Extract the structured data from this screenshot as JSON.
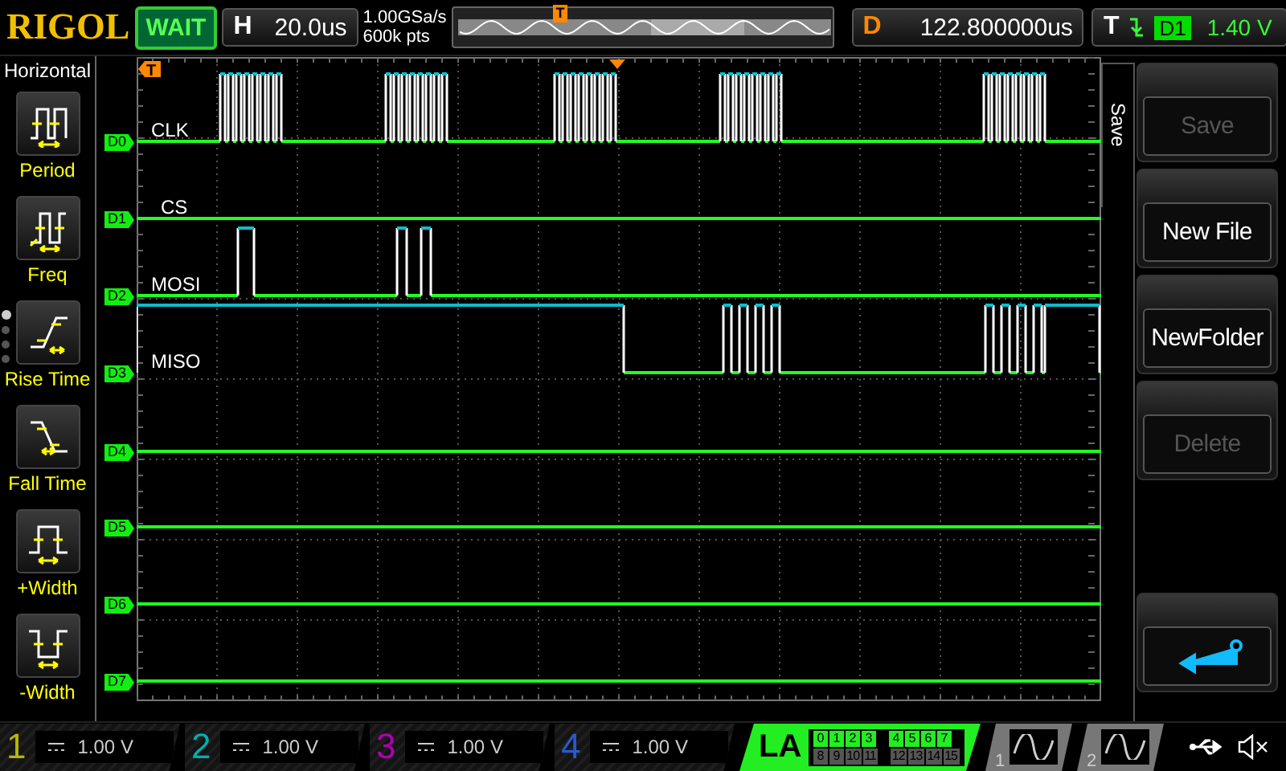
{
  "header": {
    "logo": "RIGOL",
    "run_status": "WAIT",
    "timebase": {
      "label": "H",
      "value": "20.0us"
    },
    "acquisition": {
      "sample_rate": "1.00GSa/s",
      "memory_depth": "600k pts"
    },
    "memory_marker": "T",
    "delay": {
      "label": "D",
      "value": "122.800000us"
    },
    "trigger": {
      "label": "T",
      "source": "D1",
      "threshold": "1.40 V"
    }
  },
  "measure_menu": {
    "title": "Horizontal",
    "items": [
      {
        "kind": "period",
        "label": "Period"
      },
      {
        "kind": "freq",
        "label": "Freq"
      },
      {
        "kind": "rise",
        "label": "Rise Time"
      },
      {
        "kind": "fall",
        "label": "Fall Time"
      },
      {
        "kind": "pwidth",
        "label": "+Width"
      },
      {
        "kind": "nwidth",
        "label": "-Width"
      }
    ],
    "pages": [
      {
        "selected": true
      },
      {
        "selected": false
      },
      {
        "selected": false
      },
      {
        "selected": false
      }
    ]
  },
  "plot": {
    "trigger_marker": "T",
    "channels": [
      {
        "label": "D0",
        "name": "CLK"
      },
      {
        "label": "D1",
        "name": "CS"
      },
      {
        "label": "D2",
        "name": "MOSI"
      },
      {
        "label": "D3",
        "name": "MISO"
      },
      {
        "label": "D4"
      },
      {
        "label": "D5"
      },
      {
        "label": "D6"
      },
      {
        "label": "D7"
      }
    ]
  },
  "softkeys": {
    "menu_title": "Save",
    "buttons": [
      {
        "kind": "text",
        "label": "Save",
        "disabled": true
      },
      {
        "kind": "text",
        "label": "New File",
        "disabled": false
      },
      {
        "kind": "text",
        "label": "NewFolder",
        "disabled": false
      },
      {
        "kind": "text",
        "label": "Delete",
        "disabled": true
      },
      {
        "kind": "back"
      }
    ]
  },
  "status_bar": {
    "analog_channels": [
      {
        "number": "1",
        "scale": "1.00 V",
        "color": "#b8b800"
      },
      {
        "number": "2",
        "scale": "1.00 V",
        "color": "#00b0b0"
      },
      {
        "number": "3",
        "scale": "1.00 V",
        "color": "#b000b0"
      },
      {
        "number": "4",
        "scale": "1.00 V",
        "color": "#2a5ad0"
      }
    ],
    "logic_analyzer": {
      "label": "LA",
      "bits": [
        {
          "label": "0",
          "on": true
        },
        {
          "label": "1",
          "on": true
        },
        {
          "label": "2",
          "on": true
        },
        {
          "label": "3",
          "on": true
        },
        {
          "label": "4",
          "on": true
        },
        {
          "label": "5",
          "on": true
        },
        {
          "label": "6",
          "on": true
        },
        {
          "label": "7",
          "on": true
        },
        {
          "label": "8",
          "on": false
        },
        {
          "label": "9",
          "on": false
        },
        {
          "label": "10",
          "on": false
        },
        {
          "label": "11",
          "on": false
        },
        {
          "label": "12",
          "on": false
        },
        {
          "label": "13",
          "on": false
        },
        {
          "label": "14",
          "on": false
        },
        {
          "label": "15",
          "on": false
        }
      ]
    },
    "math_channels": [
      {
        "number": "1"
      },
      {
        "number": "2"
      }
    ]
  }
}
